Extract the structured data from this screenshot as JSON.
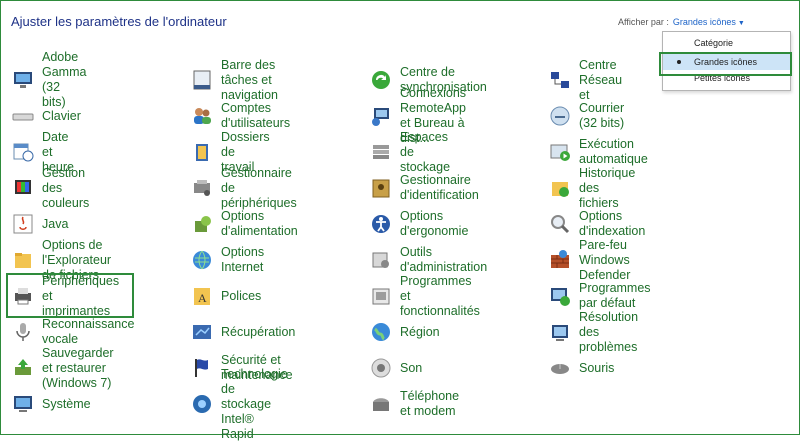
{
  "header": {
    "title": "Ajuster les paramètres de l'ordinateur",
    "view_by_label": "Afficher par :",
    "view_by_value": "Grandes icônes"
  },
  "view_menu": {
    "options": [
      "Catégorie",
      "Grandes icônes",
      "Petites icônes"
    ],
    "selected": "Grandes icônes"
  },
  "items": [
    {
      "label": "Adobe Gamma (32 bits)",
      "icon": "monitor-icon"
    },
    {
      "label": "Barre des tâches et navigation",
      "icon": "taskbar-icon"
    },
    {
      "label": "Centre de synchronisation",
      "icon": "sync-icon"
    },
    {
      "label": "Centre Réseau et",
      "icon": "network-icon"
    },
    {
      "label": "Clavier",
      "icon": "keyboard-icon"
    },
    {
      "label": "Comptes d'utilisateurs",
      "icon": "users-icon"
    },
    {
      "label": "Connexions RemoteApp et Bureau à dist...",
      "icon": "remoteapp-icon"
    },
    {
      "label": "Courrier (32 bits)",
      "icon": "mail-icon"
    },
    {
      "label": "Date et heure",
      "icon": "calendar-icon"
    },
    {
      "label": "Dossiers de travail",
      "icon": "work-folders-icon"
    },
    {
      "label": "Espaces de stockage",
      "icon": "storage-icon"
    },
    {
      "label": "Exécution automatique",
      "icon": "autoplay-icon"
    },
    {
      "label": "Gestion des couleurs",
      "icon": "color-management-icon"
    },
    {
      "label": "Gestionnaire de périphériques",
      "icon": "device-manager-icon"
    },
    {
      "label": "Gestionnaire d'identification",
      "icon": "credential-icon"
    },
    {
      "label": "Historique des fichiers",
      "icon": "file-history-icon"
    },
    {
      "label": "Java",
      "icon": "java-icon"
    },
    {
      "label": "Options d'alimentation",
      "icon": "power-icon"
    },
    {
      "label": "Options d'ergonomie",
      "icon": "ergonomics-icon"
    },
    {
      "label": "Options d'indexation",
      "icon": "indexing-icon"
    },
    {
      "label": "Options de l'Explorateur de fichiers",
      "icon": "folder-options-icon"
    },
    {
      "label": "Options Internet",
      "icon": "internet-icon"
    },
    {
      "label": "Outils d'administration",
      "icon": "admin-tools-icon"
    },
    {
      "label": "Pare-feu Windows Defender",
      "icon": "firewall-icon"
    },
    {
      "label": "Périphériques et imprimantes",
      "icon": "printer-icon"
    },
    {
      "label": "Polices",
      "icon": "fonts-icon"
    },
    {
      "label": "Programmes et fonctionnalités",
      "icon": "programs-icon"
    },
    {
      "label": "Programmes par défaut",
      "icon": "default-programs-icon"
    },
    {
      "label": "Reconnaissance vocale",
      "icon": "microphone-icon"
    },
    {
      "label": "Récupération",
      "icon": "recovery-icon"
    },
    {
      "label": "Région",
      "icon": "region-icon"
    },
    {
      "label": "Résolution des problèmes",
      "icon": "troubleshoot-icon"
    },
    {
      "label": "Sauvegarder et restaurer (Windows 7)",
      "icon": "backup-icon"
    },
    {
      "label": "Sécurité et maintenance",
      "icon": "flag-icon"
    },
    {
      "label": "Son",
      "icon": "speaker-icon"
    },
    {
      "label": "Souris",
      "icon": "mouse-icon"
    },
    {
      "label": "Système",
      "icon": "system-icon"
    },
    {
      "label": "Technologie de stockage Intel® Rapid",
      "icon": "intel-storage-icon"
    },
    {
      "label": "Téléphone et modem",
      "icon": "phone-icon"
    }
  ]
}
